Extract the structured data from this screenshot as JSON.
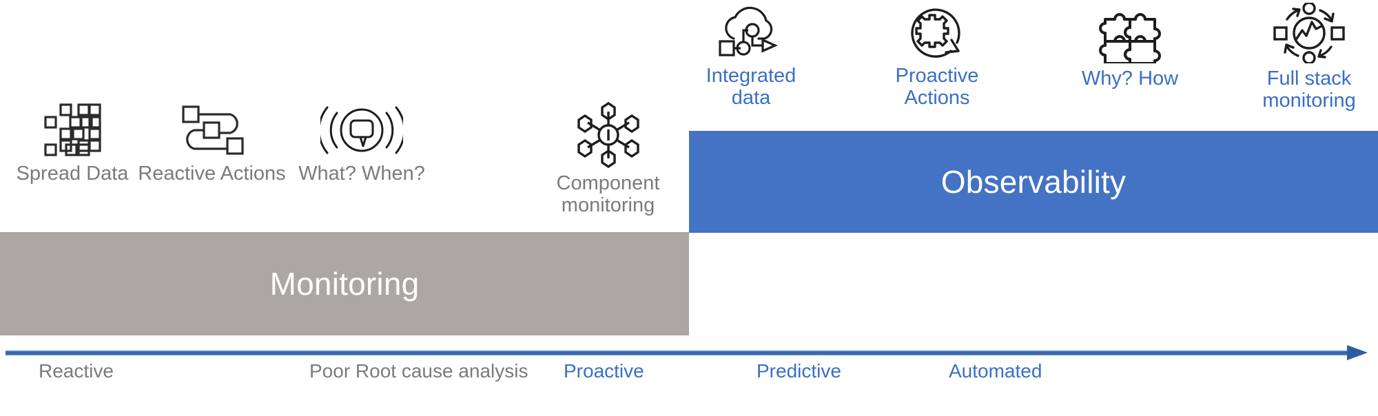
{
  "bars": {
    "monitoring": {
      "label": "Monitoring",
      "color": "#ABA7A5"
    },
    "observability": {
      "label": "Observability",
      "color": "#4472C4"
    }
  },
  "monitoring_nodes": [
    {
      "icon": "scattered-squares-icon",
      "label": "Spread Data"
    },
    {
      "icon": "reactive-flow-icon",
      "label": "Reactive Actions"
    },
    {
      "icon": "alert-broadcast-icon",
      "label": "What? When?"
    },
    {
      "icon": "component-hub-icon",
      "label": "Component\nmonitoring"
    }
  ],
  "observability_nodes": [
    {
      "icon": "cloud-integration-icon",
      "label": "Integrated\ndata"
    },
    {
      "icon": "gear-refresh-icon",
      "label": "Proactive\nActions"
    },
    {
      "icon": "puzzle-icon",
      "label": "Why? How"
    },
    {
      "icon": "full-stack-cycle-icon",
      "label": "Full stack\nmonitoring"
    }
  ],
  "axis": {
    "arrow_icon": "right-arrow-icon",
    "labels": [
      {
        "text": "Reactive",
        "tone": "gray"
      },
      {
        "text": "Poor Root cause analysis",
        "tone": "gray"
      },
      {
        "text": "Proactive",
        "tone": "blue"
      },
      {
        "text": "Predictive",
        "tone": "blue"
      },
      {
        "text": "Automated",
        "tone": "blue"
      }
    ]
  },
  "colors": {
    "monitoring_gray": "#ABA7A5",
    "observability_blue": "#4472C4",
    "caption_gray": "#7B7B7B",
    "caption_blue": "#3A6FC4",
    "axis_blue": "#2F5C9E"
  }
}
